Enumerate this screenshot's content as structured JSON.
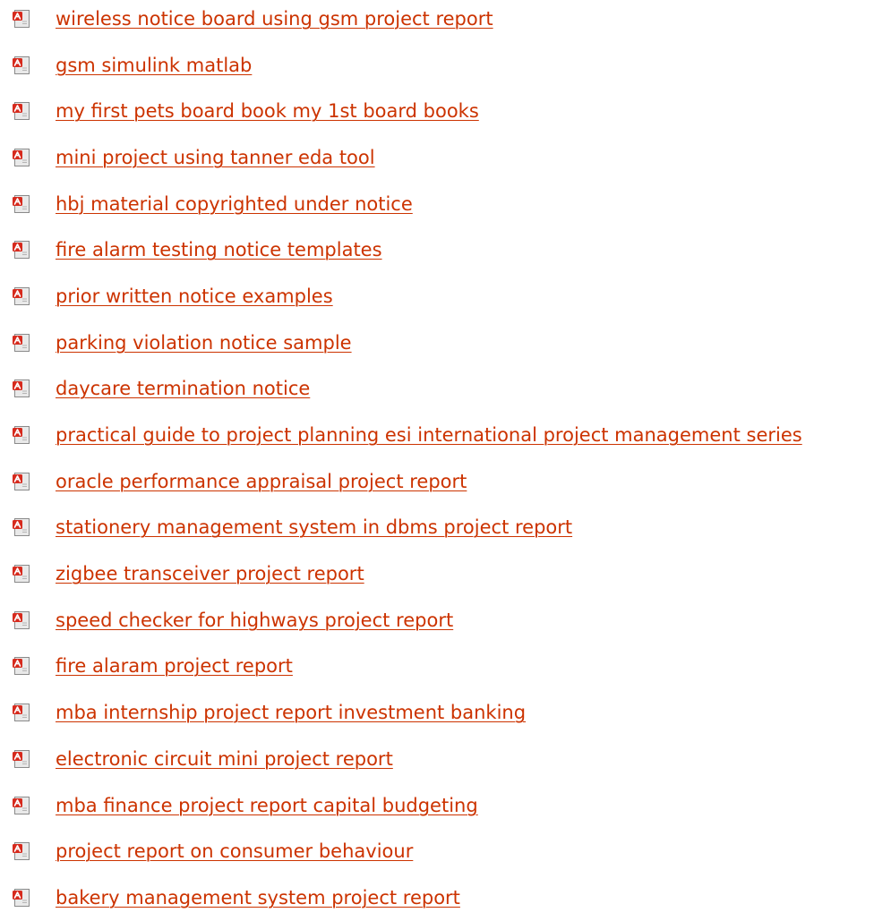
{
  "link_color": "#cc3300",
  "icon": "pdf-file-icon",
  "links": [
    {
      "label": "wireless notice board using gsm project report"
    },
    {
      "label": "gsm simulink matlab"
    },
    {
      "label": "my first pets board book my 1st board books"
    },
    {
      "label": "mini project using tanner eda tool"
    },
    {
      "label": "hbj material copyrighted under notice"
    },
    {
      "label": "fire alarm testing notice templates"
    },
    {
      "label": "prior written notice examples"
    },
    {
      "label": "parking violation notice sample"
    },
    {
      "label": "daycare termination notice"
    },
    {
      "label": "practical guide to project planning esi international project management series"
    },
    {
      "label": "oracle performance appraisal project report"
    },
    {
      "label": "stationery management system in dbms project report"
    },
    {
      "label": "zigbee transceiver project report"
    },
    {
      "label": "speed checker for highways project report"
    },
    {
      "label": "fire alaram project report"
    },
    {
      "label": "mba internship project report investment banking"
    },
    {
      "label": "electronic circuit mini project report"
    },
    {
      "label": "mba finance project report capital budgeting"
    },
    {
      "label": "project report on consumer behaviour"
    },
    {
      "label": "bakery management system project report"
    }
  ]
}
